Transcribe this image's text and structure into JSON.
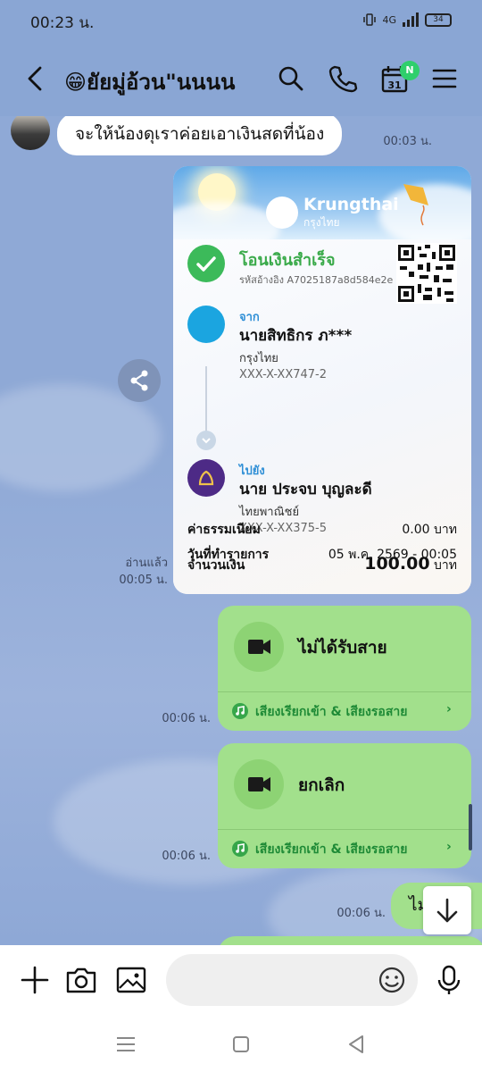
{
  "status": {
    "time": "00:23 น.",
    "network": "4G",
    "battery": "34"
  },
  "header": {
    "title": "😁ยัยมู่อ้วน\"นนนน",
    "calendar_day": "31",
    "badge": "N"
  },
  "messages": {
    "incoming_text": "จะให้น้องดุเราค่อยเอาเงินสดที่น้อง",
    "incoming_time": "00:03 น.",
    "slip_read": "อ่านแล้ว",
    "slip_time": "00:05 น."
  },
  "slip": {
    "brand": "Krungthai",
    "brand_sub": "กรุงไทย",
    "status": "โอนเงินสำเร็จ",
    "ref_label": "รหัสอ้างอิง",
    "ref": "A7025187a8d584e2e",
    "from_label": "จาก",
    "from_name": "นายสิทธิกร ภ***",
    "from_bank": "กรุงไทย",
    "from_acct": "XXX-X-XX747-2",
    "to_label": "ไปยัง",
    "to_name": "นาย ประจบ บุญละดี",
    "to_bank": "ไทยพาณิชย์",
    "to_acct": "XXX-X-XX375-5",
    "amount_label": "จำนวนเงิน",
    "amount": "100.00",
    "currency": "บาท",
    "fee_label": "ค่าธรรมเนียม",
    "fee": "0.00 บาท",
    "date_label": "วันที่ทำรายการ",
    "date": "05 พ.ค. 2569 - 00:05"
  },
  "calls": [
    {
      "title": "ไม่ได้รับสาย",
      "sub": "เสียงเรียกเข้า & เสียงรอสาย",
      "chevron": "›",
      "time": "00:06 น."
    },
    {
      "title": "ยกเลิก",
      "sub": "เสียงเรียกเข้า & เสียงรอสาย",
      "chevron": "›",
      "time": "00:06 น."
    }
  ],
  "partial": {
    "text": "ไม่",
    "time": "00:06 น."
  },
  "input": {
    "placeholder": ""
  },
  "colors": {
    "bubble_green": "#a2e08c",
    "chat_bg": "#8fa9d6",
    "success_green": "#3aaa4a"
  }
}
